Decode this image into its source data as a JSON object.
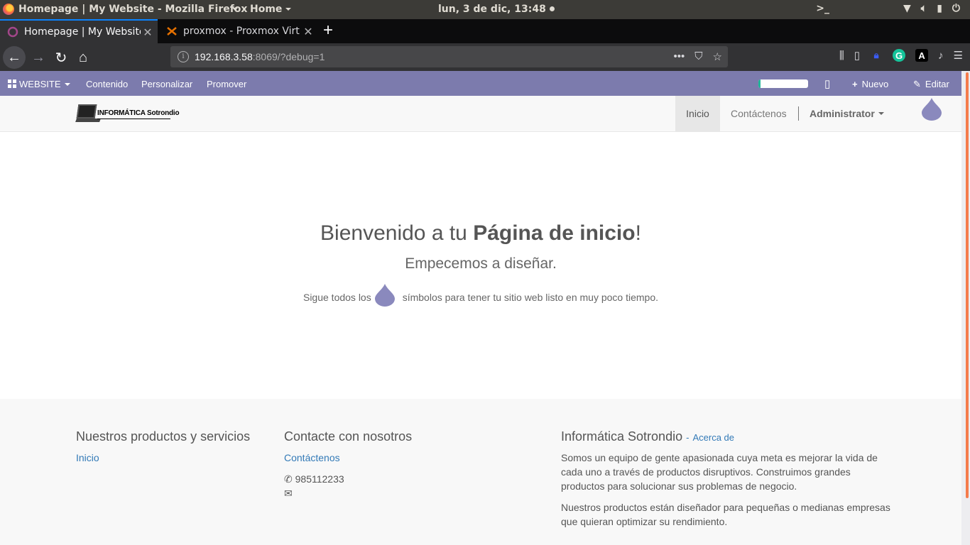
{
  "os_topbar": {
    "app_title": "Homepage | My Website - Mozilla Firefox",
    "home_menu": "Home",
    "clock": "lun,  3 de dic, 13:48"
  },
  "browser": {
    "tabs": [
      {
        "title": "Homepage | My Website",
        "active": true
      },
      {
        "title": "proxmox - Proxmox Virt",
        "active": false
      }
    ],
    "url_host": "192.168.3.58",
    "url_rest": ":8069/?debug=1",
    "new_tab": "+"
  },
  "odoo_bar": {
    "website_menu": "WEBSITE",
    "contenido": "Contenido",
    "personalizar": "Personalizar",
    "promover": "Promover",
    "nuevo": "Nuevo",
    "editar": "Editar",
    "progress_fraction": 0.04,
    "accent_color": "#7c7bad"
  },
  "site_header": {
    "logo_text": "INFORMÁTICA Sotrondio",
    "menu": {
      "inicio": "Inicio",
      "contactenos": "Contáctenos",
      "administrator": "Administrator"
    }
  },
  "hero": {
    "title_prefix": "Bienvenido a tu ",
    "title_bold": "Página de inicio",
    "title_suffix": "!",
    "subtitle": "Empecemos a diseñar.",
    "line_before": "Sigue todos los",
    "line_after": "símbolos para tener tu sitio web listo en muy poco tiempo."
  },
  "footer": {
    "col1": {
      "heading": "Nuestros productos y servicios",
      "link": "Inicio"
    },
    "col2": {
      "heading": "Contacte con nosotros",
      "link": "Contáctenos",
      "phone": "985112233"
    },
    "col3": {
      "heading": "Informática Sotrondio",
      "sep": "-",
      "about": "Acerca de",
      "para1": "Somos un equipo de gente apasionada cuya meta es mejorar la vida de cada uno a través de productos disruptivos. Construimos grandes productos para solucionar sus problemas de negocio.",
      "para2": "Nuestros productos están diseñador para pequeñas o medianas empresas que quieran optimizar su rendimiento."
    }
  }
}
